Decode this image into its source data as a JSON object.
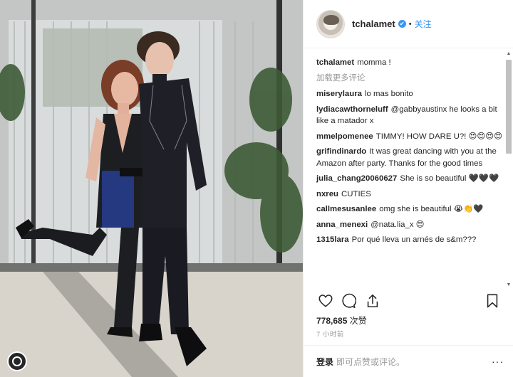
{
  "post": {
    "author": "tchalamet",
    "follow_label": "关注",
    "dot": "•",
    "verified_glyph": "✔",
    "caption_user": "tchalamet",
    "caption_text": "momma !",
    "load_more": "加载更多评论",
    "comments": [
      {
        "user": "miserylaura",
        "text": "lo mas bonito"
      },
      {
        "user": "lydiacawthorneluff",
        "text": "@gabbyaustinx he looks a bit like a matador x"
      },
      {
        "user": "mmelpomenee",
        "text": "TIMMY! HOW DARE U?! 😍😍😍😍"
      },
      {
        "user": "grifindinardo",
        "text": "It was great dancing with you at the Amazon after party. Thanks for the good times"
      },
      {
        "user": "julia_chang20060627",
        "text": "She is so beautiful 🖤🖤🖤"
      },
      {
        "user": "nxreu",
        "text": "CUTIES"
      },
      {
        "user": "callmesusanlee",
        "text": "omg she is beautiful 😭👏🖤"
      },
      {
        "user": "anna_menexi",
        "text": "@nata.lia_x 😍"
      },
      {
        "user": "1315lara",
        "text": "Por qué lleva un arnés de s&m???"
      }
    ],
    "likes_count": "778,685",
    "likes_label": "次赞",
    "time_label": "7 小时前",
    "login_label": "登录",
    "login_hint": "即可点赞或评论。",
    "more_label": "···"
  },
  "icons": {
    "heart": "heart-icon",
    "comment": "comment-icon",
    "share": "share-icon",
    "bookmark": "bookmark-icon",
    "photo_user": "user-tag-icon"
  },
  "colors": {
    "link_blue": "#3897f0",
    "muted_text": "#999999",
    "border": "#efefef"
  }
}
